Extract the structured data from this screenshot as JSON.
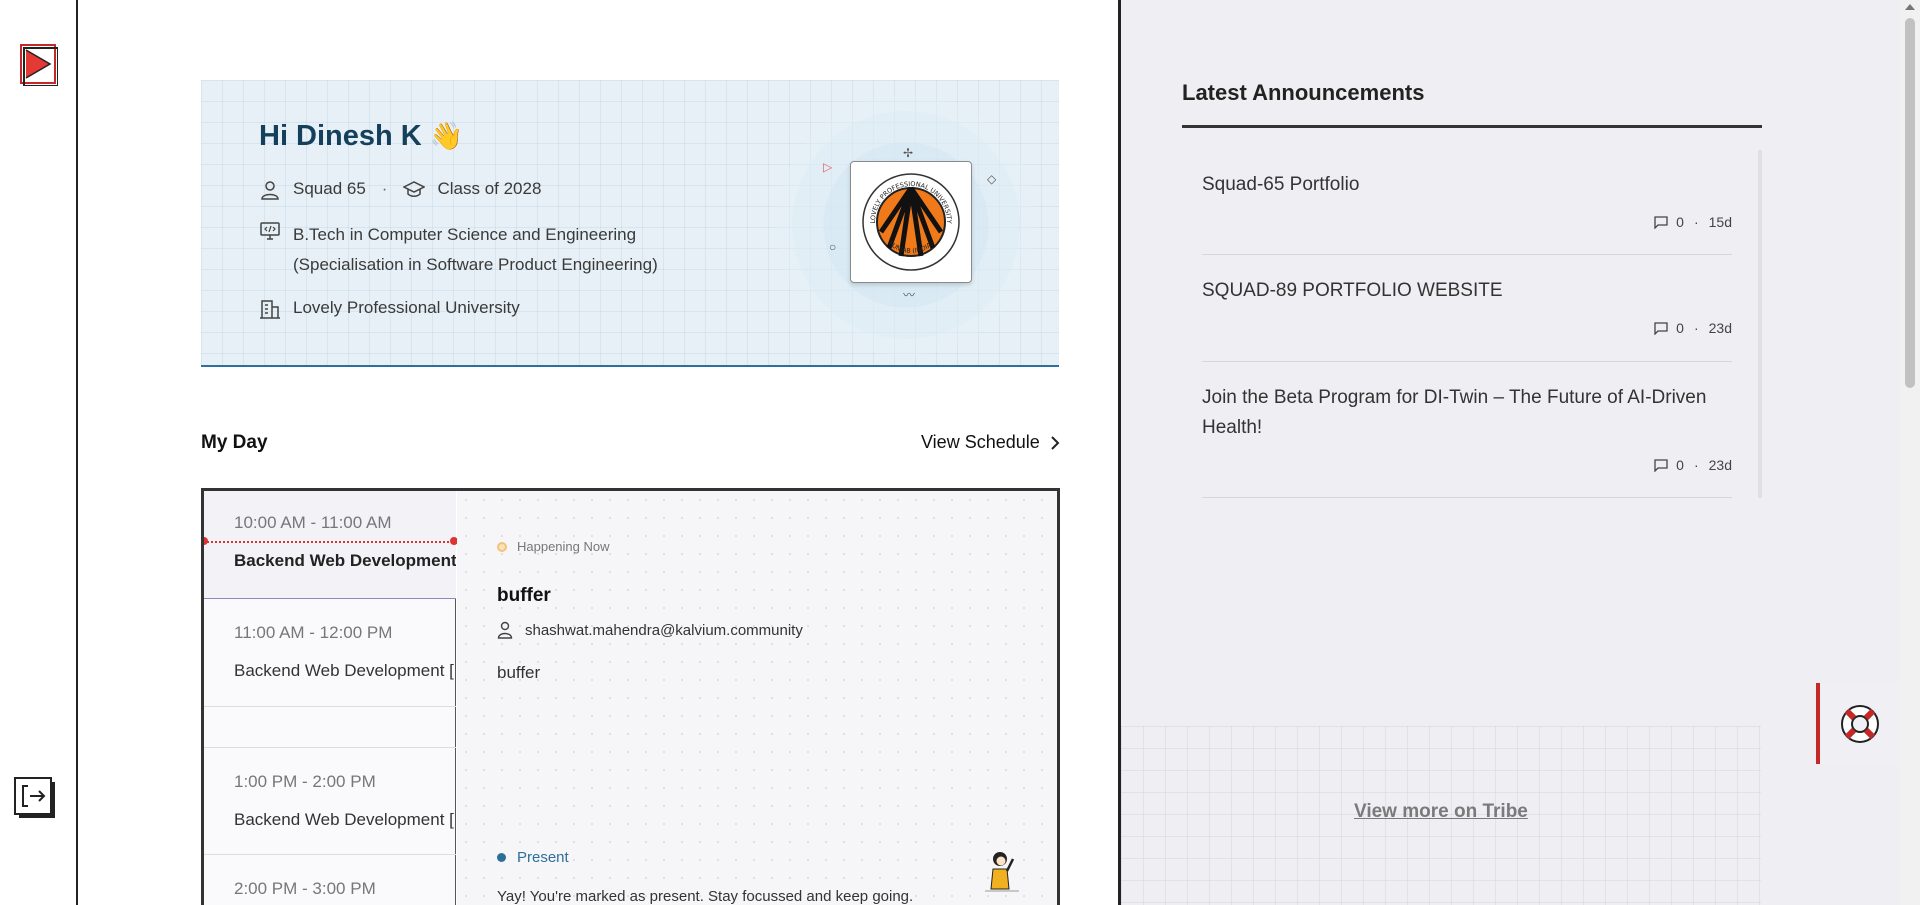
{
  "hero": {
    "greeting": "Hi Dinesh K",
    "wave_emoji": "👋",
    "squad": "Squad 65",
    "separator": "·",
    "class_of": "Class of 2028",
    "program_line1": "B.Tech in Computer Science and Engineering",
    "program_line2": "(Specialisation in Software Product Engineering)",
    "university": "Lovely Professional University",
    "logo_text_top": "LOVELY PROFESSIONAL UNIVERSITY",
    "logo_text_bottom": "PUNJAB (INDIA)"
  },
  "my_day": {
    "title": "My Day",
    "view_schedule": "View Schedule",
    "slots": [
      {
        "time": "10:00 AM - 11:00 AM",
        "name": "Backend Web Development [",
        "active": true
      },
      {
        "time": "11:00 AM - 12:00 PM",
        "name": "Backend Web Development ["
      },
      {
        "time": "1:00 PM - 2:00 PM",
        "name": "Backend Web Development ["
      },
      {
        "time": "2:00 PM - 3:00 PM",
        "name": ""
      }
    ],
    "detail": {
      "status": "Happening Now",
      "title": "buffer",
      "owner": "shashwat.mahendra@kalvium.community",
      "description": "buffer",
      "attendance": "Present",
      "attendance_message": "Yay! You're marked as present. Stay focussed and keep going."
    }
  },
  "announcements": {
    "title": "Latest Announcements",
    "items": [
      {
        "title": "Squad-65 Portfolio",
        "comments": "0",
        "age": "15d"
      },
      {
        "title": "SQUAD-89 PORTFOLIO WEBSITE",
        "comments": "0",
        "age": "23d"
      },
      {
        "title": "Join the Beta Program for DI-Twin – The Future of AI-Driven Health!",
        "comments": "0",
        "age": "23d"
      }
    ],
    "meta_separator": "·",
    "view_more": "View more on Tribe"
  },
  "colors": {
    "brand_red": "#c62828",
    "hero_title": "#14405c",
    "present_blue": "#2e6f9a",
    "happening_amber": "#f3c37a"
  }
}
